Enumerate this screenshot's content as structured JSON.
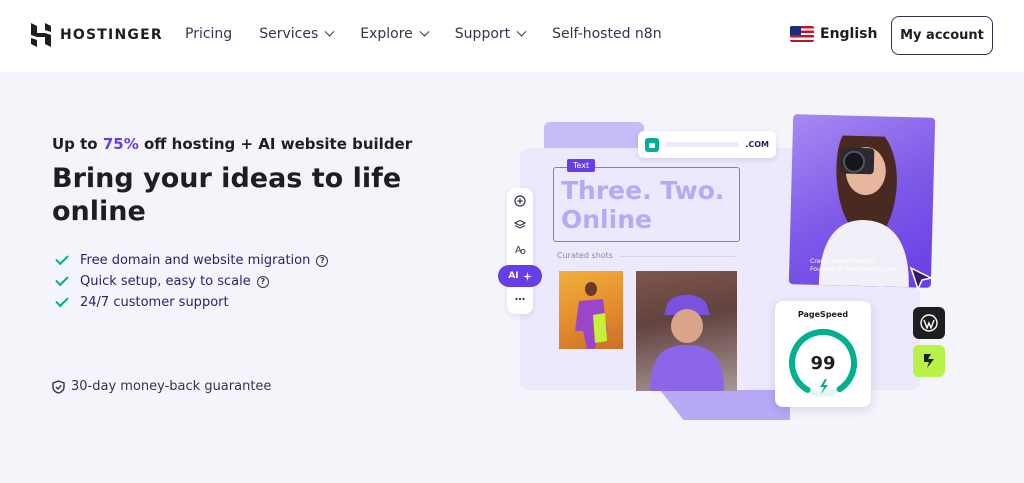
{
  "brand": {
    "name": "HOSTINGER"
  },
  "nav": {
    "links": [
      {
        "label": "Pricing",
        "dropdown": false
      },
      {
        "label": "Services",
        "dropdown": true
      },
      {
        "label": "Explore",
        "dropdown": true
      },
      {
        "label": "Support",
        "dropdown": true
      },
      {
        "label": "Self-hosted n8n",
        "dropdown": false
      }
    ],
    "language": "English",
    "account_label": "My account"
  },
  "hero": {
    "promo_prefix": "Up to ",
    "promo_highlight": "75%",
    "promo_suffix": " off hosting + AI website builder",
    "title": "Bring your ideas to life online",
    "features": [
      {
        "text": "Free domain and website migration",
        "help": true
      },
      {
        "text": "Quick setup, easy to scale",
        "help": true
      },
      {
        "text": "24/7 customer support",
        "help": false
      }
    ],
    "guarantee": "30-day money-back guarantee"
  },
  "builder_mock": {
    "url_suffix": ".COM",
    "text_tag": "Text",
    "headline_line1": "Three. Two.",
    "headline_line2": "Online",
    "curated_label": "Curated shots",
    "ai_label": "AI",
    "caption_line1": "Credit: Anna François",
    "caption_line2": "Founder of annafrancois.com",
    "pagespeed_title": "PageSpeed",
    "pagespeed_score": "99",
    "pagespeed_fraction": 0.99
  },
  "colors": {
    "accent": "#673de6",
    "success": "#00b090",
    "text": "#1d1e20",
    "background": "#f4f4fb"
  }
}
